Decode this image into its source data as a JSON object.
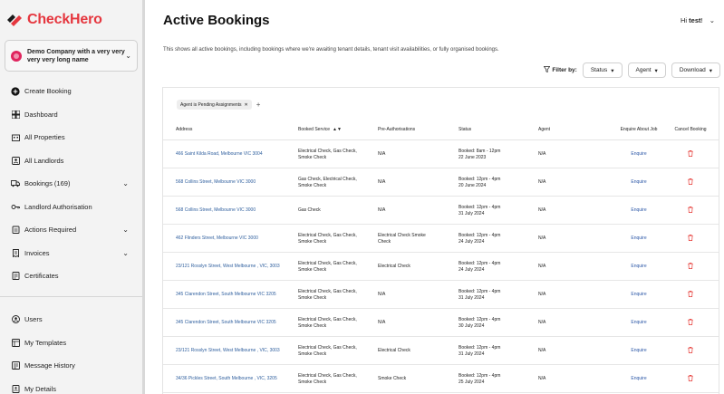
{
  "brand": {
    "name": "CheckHero",
    "accent": "#e5373f"
  },
  "company": {
    "name": "Demo Company with a very very very very long name"
  },
  "sidebar": {
    "items": [
      {
        "label": "Create Booking",
        "icon": "plus-circle-icon",
        "chevron": false
      },
      {
        "label": "Dashboard",
        "icon": "grid-icon",
        "chevron": false
      },
      {
        "label": "All Properties",
        "icon": "building-icon",
        "chevron": false
      },
      {
        "label": "All Landlords",
        "icon": "id-card-icon",
        "chevron": false
      },
      {
        "label": "Bookings (169)",
        "icon": "truck-icon",
        "chevron": true
      },
      {
        "label": "Landlord Authorisation",
        "icon": "key-icon",
        "chevron": false
      },
      {
        "label": "Actions Required",
        "icon": "clipboard-icon",
        "chevron": true
      },
      {
        "label": "Invoices",
        "icon": "invoice-icon",
        "chevron": true
      },
      {
        "label": "Certificates",
        "icon": "certificate-icon",
        "chevron": false
      }
    ],
    "bottom_items": [
      {
        "label": "Users",
        "icon": "user-icon"
      },
      {
        "label": "My Templates",
        "icon": "template-icon"
      },
      {
        "label": "Message History",
        "icon": "message-icon"
      },
      {
        "label": "My Details",
        "icon": "details-icon"
      }
    ]
  },
  "header": {
    "title": "Active Bookings",
    "greeting_prefix": "Hi",
    "user": "test",
    "greeting_suffix": "!",
    "description": "This shows all active bookings, including bookings where we're awaiting tenant details, tenant visit availabilities, or fully organised bookings."
  },
  "filters": {
    "label": "Filter by:",
    "status": "Status",
    "agent": "Agent",
    "download": "Download"
  },
  "chips": [
    {
      "label": "Agent is Pending Assignments"
    }
  ],
  "table": {
    "columns": {
      "address": "Address",
      "service": "Booked Service",
      "preauth": "Pre-Authorisations",
      "status": "Status",
      "agent": "Agent",
      "enquire": "Enquire About Job",
      "cancel": "Cancel Booking"
    },
    "rows": [
      {
        "address": "466 Saint Kilda Road, Melbourne  VIC 3004",
        "service": "Electrical Check, Gas Check, Smoke Check",
        "preauth": "N/A",
        "status_line1": "Booked: 8am - 12pm",
        "status_line2": "22 June 2023",
        "agent": "N/A",
        "enquire": "Enquire"
      },
      {
        "address": "568 Collins Street, Melbourne  VIC 3000",
        "service": "Gas Check, Electrical Check, Smoke Check",
        "preauth": "N/A",
        "status_line1": "Booked: 12pm - 4pm",
        "status_line2": "20 June 2024",
        "agent": "N/A",
        "enquire": "Enquire"
      },
      {
        "address": "568 Collins Street, Melbourne  VIC 3000",
        "service": "Gas Check",
        "preauth": "N/A",
        "status_line1": "Booked: 12pm - 4pm",
        "status_line2": "31 July 2024",
        "agent": "N/A",
        "enquire": "Enquire"
      },
      {
        "address": "462 Flinders Street, Melbourne  VIC 3000",
        "service": "Electrical Check, Gas Check, Smoke Check",
        "preauth": "Electrical Check Smoke Check",
        "status_line1": "Booked: 12pm - 4pm",
        "status_line2": "24 July 2024",
        "agent": "N/A",
        "enquire": "Enquire"
      },
      {
        "address": "23/121 Rosslyn Street, West Melbourne , VIC, 3003",
        "service": "Electrical Check, Gas Check, Smoke Check",
        "preauth": "Electrical Check",
        "status_line1": "Booked: 12pm - 4pm",
        "status_line2": "24 July 2024",
        "agent": "N/A",
        "enquire": "Enquire"
      },
      {
        "address": "345 Clarendon Street, South Melbourne  VIC 3205",
        "service": "Electrical Check, Gas Check, Smoke Check",
        "preauth": "N/A",
        "status_line1": "Booked: 12pm - 4pm",
        "status_line2": "31 July 2024",
        "agent": "N/A",
        "enquire": "Enquire"
      },
      {
        "address": "345 Clarendon Street, South Melbourne  VIC 3205",
        "service": "Electrical Check, Gas Check, Smoke Check",
        "preauth": "N/A",
        "status_line1": "Booked: 12pm - 4pm",
        "status_line2": "30 July 2024",
        "agent": "N/A",
        "enquire": "Enquire"
      },
      {
        "address": "23/121 Rosslyn Street, West Melbourne , VIC, 3003",
        "service": "Electrical Check, Gas Check, Smoke Check",
        "preauth": "Electrical Check",
        "status_line1": "Booked: 12pm - 4pm",
        "status_line2": "31 July 2024",
        "agent": "N/A",
        "enquire": "Enquire"
      },
      {
        "address": "34/36 Pickles Street, South Melbourne , VIC, 3205",
        "service": "Electrical Check, Gas Check, Smoke Check",
        "preauth": "Smoke Check",
        "status_line1": "Booked: 12pm - 4pm",
        "status_line2": "25 July 2024",
        "agent": "N/A",
        "enquire": "Enquire"
      }
    ]
  },
  "colors": {
    "link": "#2f5f9e",
    "trash": "#e53935"
  }
}
